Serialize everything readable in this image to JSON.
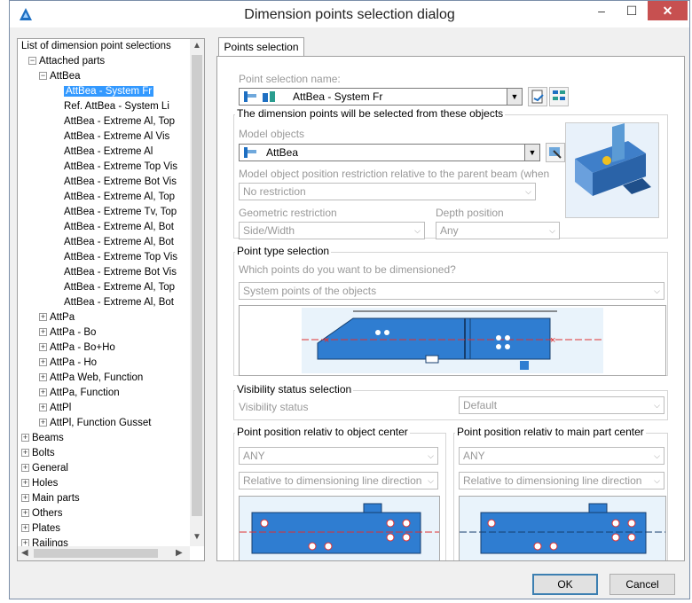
{
  "window": {
    "title": "Dimension points selection dialog",
    "min": "–",
    "max": "☐",
    "close": "✕"
  },
  "tree": {
    "rows": [
      {
        "label": "List of dimension point selections",
        "exp": ""
      },
      {
        "label": "Attached parts",
        "exp": "−"
      },
      {
        "label": "AttBea",
        "exp": "−"
      },
      {
        "label": "AttBea - System Fr",
        "exp": ""
      },
      {
        "label": "Ref. AttBea - System Li",
        "exp": ""
      },
      {
        "label": "AttBea - Extreme Al, Top",
        "exp": ""
      },
      {
        "label": "AttBea - Extreme Al Vis",
        "exp": ""
      },
      {
        "label": "AttBea - Extreme Al",
        "exp": ""
      },
      {
        "label": "AttBea - Extreme Top Vis",
        "exp": ""
      },
      {
        "label": "AttBea - Extreme Bot Vis",
        "exp": ""
      },
      {
        "label": "AttBea - Extreme Al, Top",
        "exp": ""
      },
      {
        "label": "AttBea - Extreme Tv, Top",
        "exp": ""
      },
      {
        "label": "AttBea - Extreme Al, Bot",
        "exp": ""
      },
      {
        "label": "AttBea - Extreme Al, Bot",
        "exp": ""
      },
      {
        "label": "AttBea - Extreme Top Vis",
        "exp": ""
      },
      {
        "label": "AttBea - Extreme Bot Vis",
        "exp": ""
      },
      {
        "label": "AttBea - Extreme Al, Top",
        "exp": ""
      },
      {
        "label": "AttBea - Extreme Al, Bot",
        "exp": ""
      },
      {
        "label": "AttPa",
        "exp": "+"
      },
      {
        "label": "AttPa - Bo",
        "exp": "+"
      },
      {
        "label": "AttPa - Bo+Ho",
        "exp": "+"
      },
      {
        "label": "AttPa - Ho",
        "exp": "+"
      },
      {
        "label": "AttPa Web, Function",
        "exp": "+"
      },
      {
        "label": "AttPa, Function",
        "exp": "+"
      },
      {
        "label": "AttPl",
        "exp": "+"
      },
      {
        "label": "AttPl, Function Gusset",
        "exp": "+"
      },
      {
        "label": "Beams",
        "exp": "+"
      },
      {
        "label": "Bolts",
        "exp": "+"
      },
      {
        "label": "General",
        "exp": "+"
      },
      {
        "label": "Holes",
        "exp": "+"
      },
      {
        "label": "Main parts",
        "exp": "+"
      },
      {
        "label": "Others",
        "exp": "+"
      },
      {
        "label": "Plates",
        "exp": "+"
      },
      {
        "label": "Railings",
        "exp": "+"
      }
    ]
  },
  "tab": "Points selection",
  "form": {
    "point_selection_name_label": "Point selection name:",
    "point_selection_name_value": "AttBea - System Fr",
    "objects_group": "The dimension points will be selected from these objects",
    "model_objects_label": "Model objects",
    "model_objects_value": "AttBea",
    "restriction_label": "Model object position restriction relative to the parent beam (when",
    "restriction_value": "No restriction",
    "geometric_label": "Geometric restriction",
    "geometric_value": "Side/Width",
    "depth_label": "Depth position",
    "depth_value": "Any",
    "point_type_group": "Point type selection",
    "point_type_question": "Which points do you want to be dimensioned?",
    "point_type_value": "System points of the objects",
    "visibility_group": "Visibility status selection",
    "visibility_label": "Visibility status",
    "visibility_value": "Default",
    "obj_center_group": "Point position relativ to object center",
    "obj_center_any": "ANY",
    "obj_center_dir": "Relative to dimensioning line direction",
    "main_center_group": "Point position relativ to main part center",
    "main_center_any": "ANY",
    "main_center_dir": "Relative to dimensioning line direction"
  },
  "buttons": {
    "ok": "OK",
    "cancel": "Cancel"
  }
}
